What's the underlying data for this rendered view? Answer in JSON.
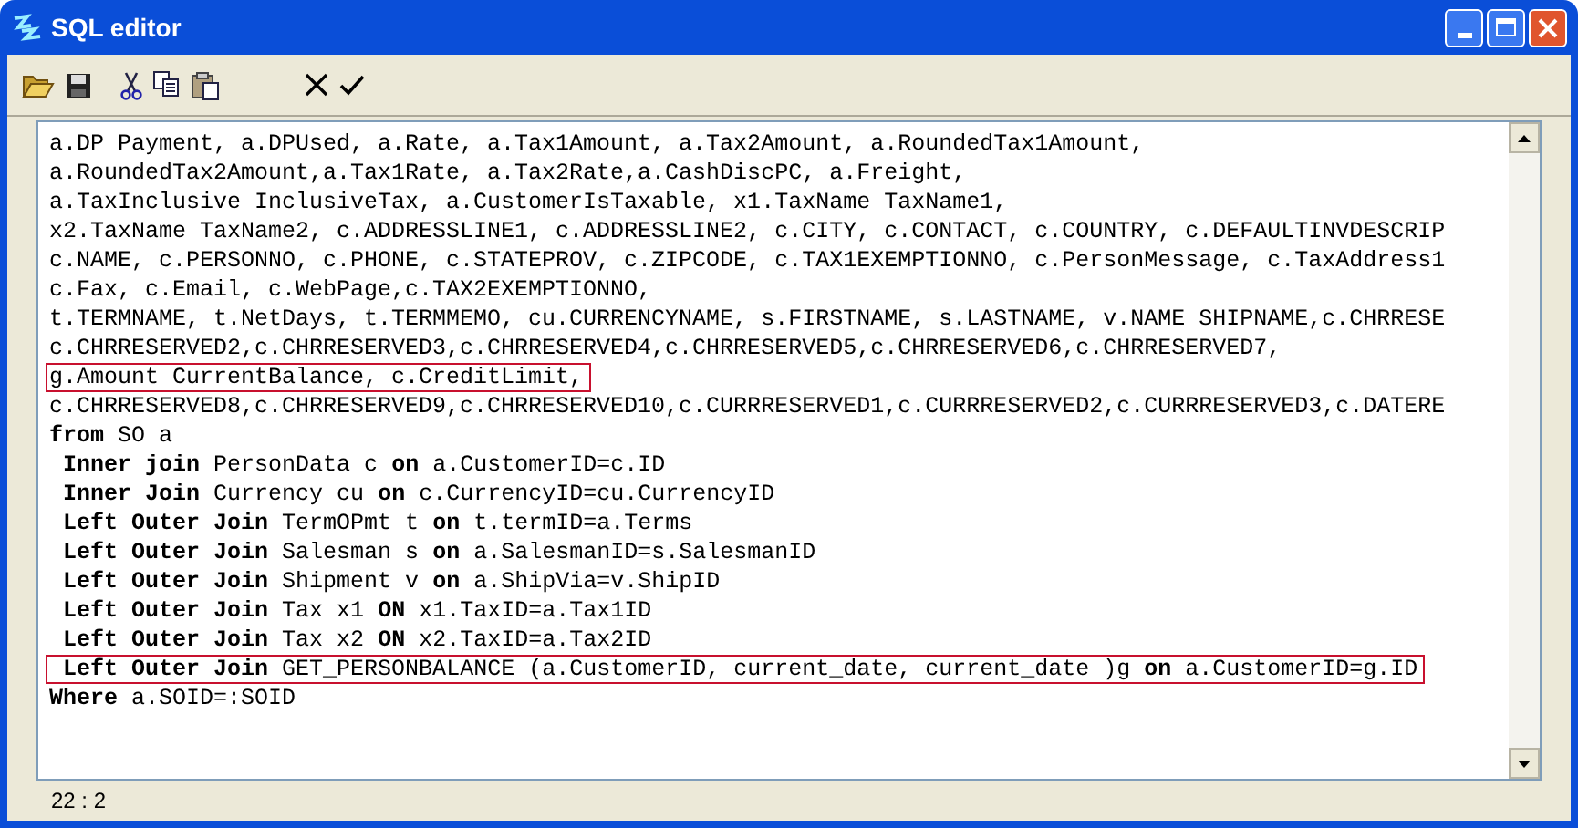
{
  "window": {
    "title": "SQL editor"
  },
  "editor": {
    "lines": [
      {
        "text": "a.DP Payment, a.DPUsed, a.Rate, a.Tax1Amount, a.Tax2Amount, a.RoundedTax1Amount,",
        "highlighted": false
      },
      {
        "text": "a.RoundedTax2Amount,a.Tax1Rate, a.Tax2Rate,a.CashDiscPC, a.Freight,",
        "highlighted": false
      },
      {
        "text": "a.TaxInclusive InclusiveTax, a.CustomerIsTaxable, x1.TaxName TaxName1,",
        "highlighted": false
      },
      {
        "text": "x2.TaxName TaxName2, c.ADDRESSLINE1, c.ADDRESSLINE2, c.CITY, c.CONTACT, c.COUNTRY, c.DEFAULTINVDESCRIP",
        "highlighted": false
      },
      {
        "text": "c.NAME, c.PERSONNO, c.PHONE, c.STATEPROV, c.ZIPCODE, c.TAX1EXEMPTIONNO, c.PersonMessage, c.TaxAddress1",
        "highlighted": false
      },
      {
        "text": "c.Fax, c.Email, c.WebPage,c.TAX2EXEMPTIONNO,",
        "highlighted": false
      },
      {
        "text": "t.TERMNAME, t.NetDays, t.TERMMEMO, cu.CURRENCYNAME, s.FIRSTNAME, s.LASTNAME, v.NAME SHIPNAME,c.CHRRESE",
        "highlighted": false
      },
      {
        "text": "c.CHRRESERVED2,c.CHRRESERVED3,c.CHRRESERVED4,c.CHRRESERVED5,c.CHRRESERVED6,c.CHRRESERVED7,",
        "highlighted": false
      },
      {
        "text": "g.Amount CurrentBalance, c.CreditLimit,",
        "highlighted": true
      },
      {
        "text": "c.CHRRESERVED8,c.CHRRESERVED9,c.CHRRESERVED10,c.CURRRESERVED1,c.CURRRESERVED2,c.CURRRESERVED3,c.DATERE",
        "highlighted": false
      },
      {
        "text": "**from** SO a",
        "highlighted": false
      },
      {
        "text": " **Inner join** PersonData c **on** a.CustomerID=c.ID",
        "highlighted": false
      },
      {
        "text": " **Inner Join** Currency cu **on** c.CurrencyID=cu.CurrencyID",
        "highlighted": false
      },
      {
        "text": " **Left Outer Join** TermOPmt t **on** t.termID=a.Terms",
        "highlighted": false
      },
      {
        "text": " **Left Outer Join** Salesman s **on** a.SalesmanID=s.SalesmanID",
        "highlighted": false
      },
      {
        "text": " **Left Outer Join** Shipment v **on** a.ShipVia=v.ShipID",
        "highlighted": false
      },
      {
        "text": " **Left Outer Join** Tax x1 **ON** x1.TaxID=a.Tax1ID",
        "highlighted": false
      },
      {
        "text": " **Left Outer Join** Tax x2 **ON** x2.TaxID=a.Tax2ID",
        "highlighted": false
      },
      {
        "text": " **Left Outer Join** GET_PERSONBALANCE (a.CustomerID, current_date, current_date )g **on** a.CustomerID=g.ID",
        "highlighted": true
      },
      {
        "text": "**Where** a.SOID=:SOID",
        "highlighted": false
      }
    ]
  },
  "status_bar": {
    "position": "22 : 2"
  }
}
